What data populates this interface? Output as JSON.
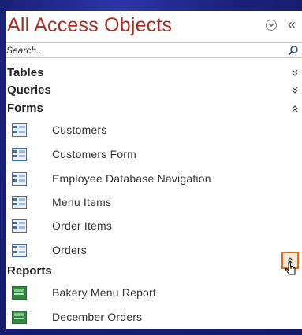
{
  "pane": {
    "title": "All Access Objects",
    "collapse_glyph": "«",
    "menu_icon": "chevron-down-circle-icon"
  },
  "search": {
    "placeholder": "Search...",
    "icon": "search-icon"
  },
  "groups": [
    {
      "label": "Tables",
      "state": "collapsed",
      "icon": "double-chevron-down-icon"
    },
    {
      "label": "Queries",
      "state": "collapsed",
      "icon": "double-chevron-down-icon"
    },
    {
      "label": "Forms",
      "state": "expanded",
      "icon": "double-chevron-up-icon",
      "items": [
        {
          "label": "Customers",
          "icon": "form-icon"
        },
        {
          "label": "Customers Form",
          "icon": "form-icon"
        },
        {
          "label": "Employee Database Navigation",
          "icon": "form-icon"
        },
        {
          "label": "Menu Items",
          "icon": "form-icon"
        },
        {
          "label": "Order Items",
          "icon": "form-icon"
        },
        {
          "label": "Orders",
          "icon": "form-icon"
        }
      ]
    },
    {
      "label": "Reports",
      "state": "expanded",
      "icon": "double-chevron-up-icon",
      "items": [
        {
          "label": "Bakery Menu Report",
          "icon": "report-icon"
        },
        {
          "label": "December Orders",
          "icon": "report-icon"
        }
      ]
    }
  ],
  "colors": {
    "title": "#b02a20",
    "background": "#1c237a",
    "highlight_border": "#e36b1a",
    "form_icon": "#3b6fb6",
    "report_icon": "#2e8b3e"
  }
}
